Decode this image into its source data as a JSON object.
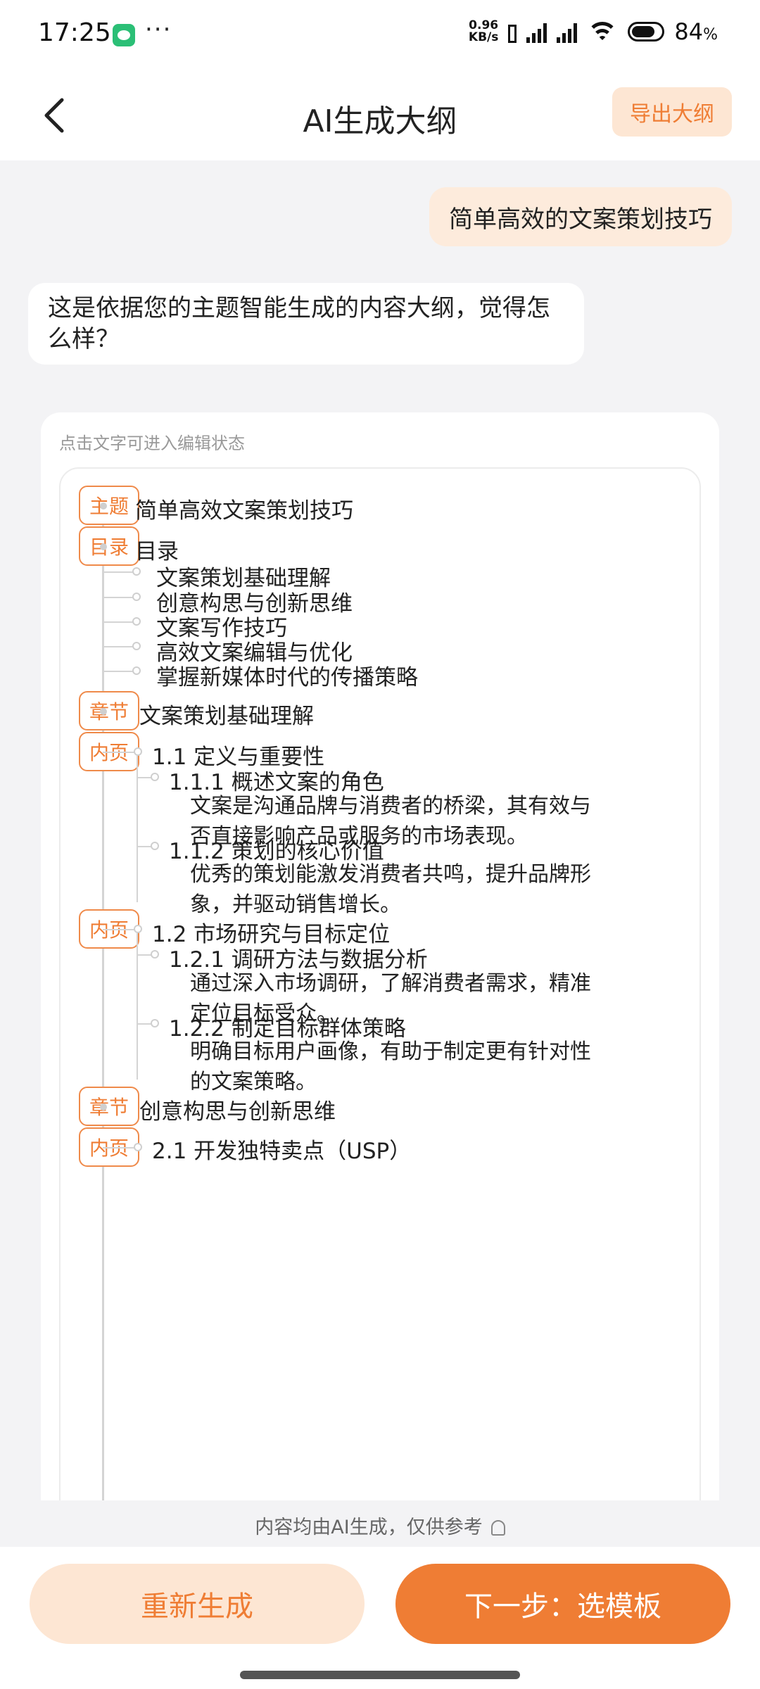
{
  "status_bar": {
    "time": "17:25",
    "dots": "···",
    "net_speed_top": "0.96",
    "net_speed_bottom": "KB/s",
    "battery": "84",
    "battery_unit": "%"
  },
  "header": {
    "title": "AI生成大纲",
    "export_label": "导出大纲"
  },
  "chat": {
    "user_message": "简单高效的文案策划技巧",
    "ai_message": "这是依据您的主题智能生成的内容大纲，觉得怎么样？"
  },
  "outline": {
    "edit_hint": "点击文字可进入编辑状态",
    "tags": {
      "topic": "主题",
      "toc": "目录",
      "chapter": "章节",
      "page": "内页"
    },
    "topic": "简单高效文案策划技巧",
    "toc_title": "目录",
    "toc_items": [
      "文案策划基础理解",
      "创意构思与创新思维",
      "文案写作技巧",
      "高效文案编辑与优化",
      "掌握新媒体时代的传播策略"
    ],
    "chapter1": "文案策划基础理解",
    "page1": "1.1 定义与重要性",
    "s111": "1.1.1 概述文案的角色",
    "s111_body": "文案是沟通品牌与消费者的桥梁，其有效与否直接影响产品或服务的市场表现。",
    "s112": "1.1.2 策划的核心价值",
    "s112_body": "优秀的策划能激发消费者共鸣，提升品牌形象，并驱动销售增长。",
    "page2": "1.2 市场研究与目标定位",
    "s121": "1.2.1 调研方法与数据分析",
    "s121_body": "通过深入市场调研，了解消费者需求，精准定位目标受众。",
    "s122": "1.2.2 制定目标群体策略",
    "s122_body": "明确目标用户画像，有助于制定更有针对性的文案策略。",
    "chapter2": "创意构思与创新思维",
    "page3": "2.1 开发独特卖点（USP）"
  },
  "disclaimer": "内容均由AI生成，仅供参考",
  "buttons": {
    "regenerate": "重新生成",
    "next": "下一步：选模板"
  },
  "colors": {
    "accent": "#ef7d34",
    "accent_light": "#fde6d3",
    "user_bubble": "#fdebdc"
  }
}
